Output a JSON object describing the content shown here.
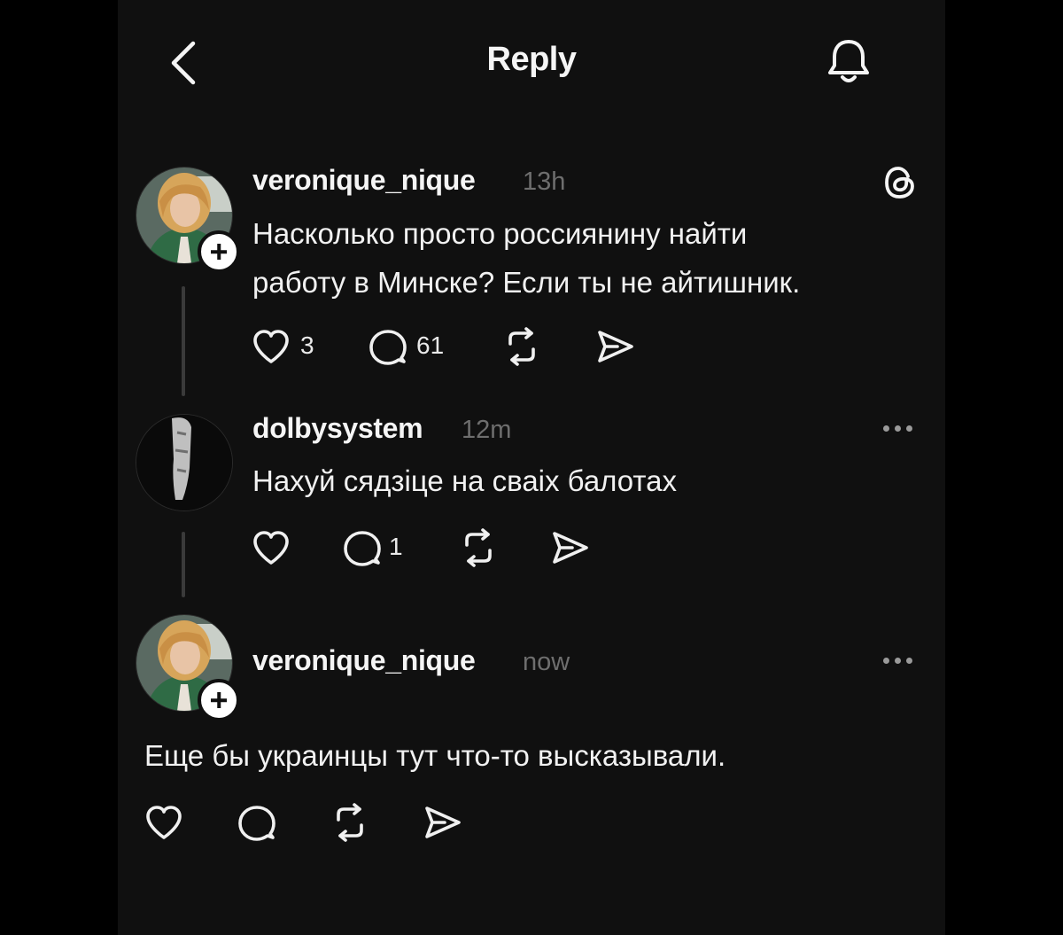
{
  "header": {
    "title": "Reply"
  },
  "posts": [
    {
      "username": "veronique_nique",
      "time": "13h",
      "lines": [
        "Насколько просто россиянину найти",
        "работу в Минске? Если ты не айтишник."
      ],
      "likes": "3",
      "replies": "61"
    },
    {
      "username": "dolbysystem",
      "time": "12m",
      "lines": [
        "Нахуй сядзіце на сваіх балотах"
      ],
      "likes": "",
      "replies": "1"
    },
    {
      "username": "veronique_nique",
      "time": "now",
      "lines": [
        "Еще бы украинцы тут что-то высказывали."
      ],
      "likes": "",
      "replies": ""
    }
  ],
  "icons": {
    "back": "chevron-left-icon",
    "notifications": "bell-icon",
    "threads": "threads-logo-icon",
    "like": "heart-icon",
    "reply": "comment-icon",
    "repost": "repost-icon",
    "share": "send-icon",
    "more": "more-icon",
    "follow": "plus-icon"
  },
  "colors": {
    "background": "#101010",
    "text": "#f3f3f3",
    "muted": "#6e6e6e"
  }
}
